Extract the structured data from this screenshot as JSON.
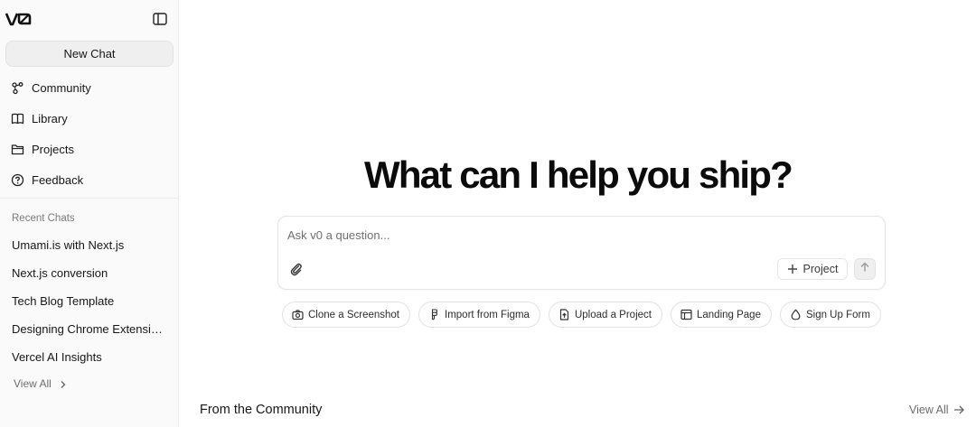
{
  "sidebar": {
    "logo_text": "v0",
    "new_chat_label": "New Chat",
    "nav": [
      {
        "label": "Community",
        "icon": "community-icon"
      },
      {
        "label": "Library",
        "icon": "book-icon"
      },
      {
        "label": "Projects",
        "icon": "folder-icon"
      },
      {
        "label": "Feedback",
        "icon": "help-circle-icon"
      }
    ],
    "recent_label": "Recent Chats",
    "recent": [
      "Umami.is with Next.js",
      "Next.js conversion",
      "Tech Blog Template",
      "Designing Chrome Extensi…",
      "Vercel AI Insights"
    ],
    "view_all_label": "View All"
  },
  "main": {
    "heading": "What can I help you ship?",
    "prompt_placeholder": "Ask v0 a question...",
    "project_label": "Project",
    "chips": [
      {
        "label": "Clone a Screenshot",
        "icon": "camera-icon"
      },
      {
        "label": "Import from Figma",
        "icon": "figma-icon"
      },
      {
        "label": "Upload a Project",
        "icon": "file-upload-icon"
      },
      {
        "label": "Landing Page",
        "icon": "layout-icon"
      },
      {
        "label": "Sign Up Form",
        "icon": "droplet-icon"
      }
    ],
    "community_title": "From the Community",
    "view_all_label": "View All"
  },
  "colors": {
    "sidebar_bg": "#fafafa",
    "new_chat_bg": "#efefef",
    "text": "#171717",
    "muted": "#7a7a7a",
    "border": "#e4e4e4"
  }
}
